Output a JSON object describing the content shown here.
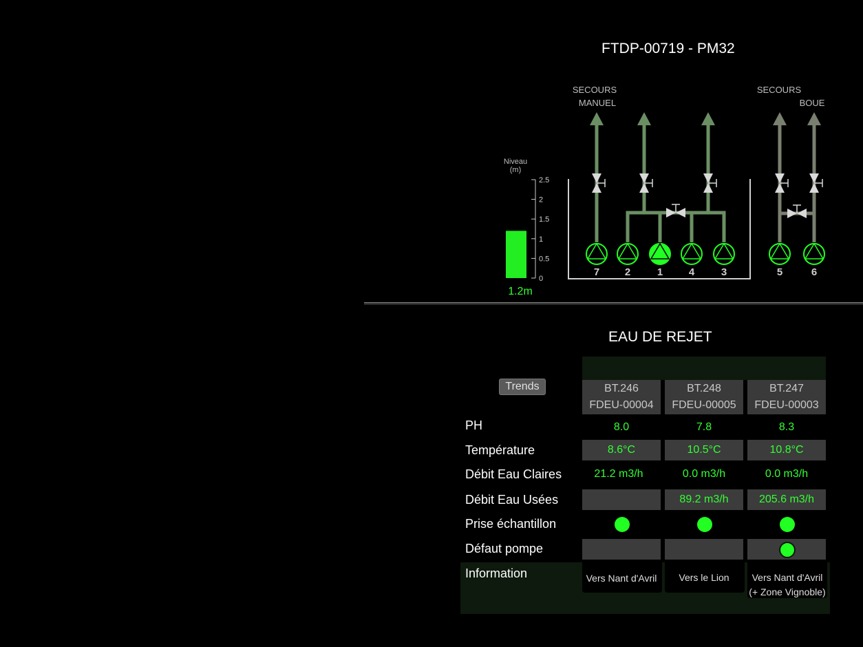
{
  "header": {
    "title": "FTDP-00719 - PM32"
  },
  "diagram": {
    "labels": {
      "secours_manuel_1": "SECOURS",
      "secours_manuel_2": "MANUEL",
      "secours_boue_1": "SECOURS",
      "boue": "BOUE"
    },
    "level": {
      "title_1": "Niveau",
      "title_2": "(m)",
      "value": 1.2,
      "value_label": "1.2m",
      "ticks": [
        "2.5",
        "2",
        "1.5",
        "1",
        "0.5",
        "0"
      ],
      "range": [
        0,
        2.5
      ]
    },
    "pumps": [
      {
        "number": "7",
        "running": false
      },
      {
        "number": "2",
        "running": false
      },
      {
        "number": "1",
        "running": true
      },
      {
        "number": "4",
        "running": false
      },
      {
        "number": "3",
        "running": false
      },
      {
        "number": "5",
        "running": false
      },
      {
        "number": "6",
        "running": false
      }
    ]
  },
  "section": {
    "title": "EAU DE REJET",
    "trends_label": "Trends"
  },
  "columns": [
    {
      "line1": "BT.246",
      "line2": "FDEU-00004"
    },
    {
      "line1": "BT.248",
      "line2": "FDEU-00005"
    },
    {
      "line1": "BT.247",
      "line2": "FDEU-00003"
    }
  ],
  "rows": {
    "ph": {
      "label": "PH",
      "values": [
        "8.0",
        "7.8",
        "8.3"
      ]
    },
    "temperature": {
      "label": "Température",
      "values": [
        "8.6°C",
        "10.5°C",
        "10.8°C"
      ]
    },
    "debit_claires": {
      "label": "Débit Eau Claires",
      "values": [
        "21.2 m3/h",
        "0.0 m3/h",
        "0.0 m3/h"
      ]
    },
    "debit_usees": {
      "label": "Débit Eau Usées",
      "values": [
        "",
        "89.2 m3/h",
        "205.6 m3/h"
      ]
    },
    "prise": {
      "label": "Prise échantillon"
    },
    "defaut": {
      "label": "Défaut pompe"
    },
    "information": {
      "label": "Information",
      "values": [
        {
          "line1": "Vers Nant d'Avril",
          "line2": ""
        },
        {
          "line1": "Vers le Lion",
          "line2": ""
        },
        {
          "line1": "Vers Nant d'Avril",
          "line2": "(+ Zone Vignoble)"
        }
      ]
    }
  },
  "colors": {
    "pipe": "#6b8f63",
    "pipe_right": "#7a8070",
    "accent_green": "#22ff22",
    "valve": "#d9d9d9"
  }
}
